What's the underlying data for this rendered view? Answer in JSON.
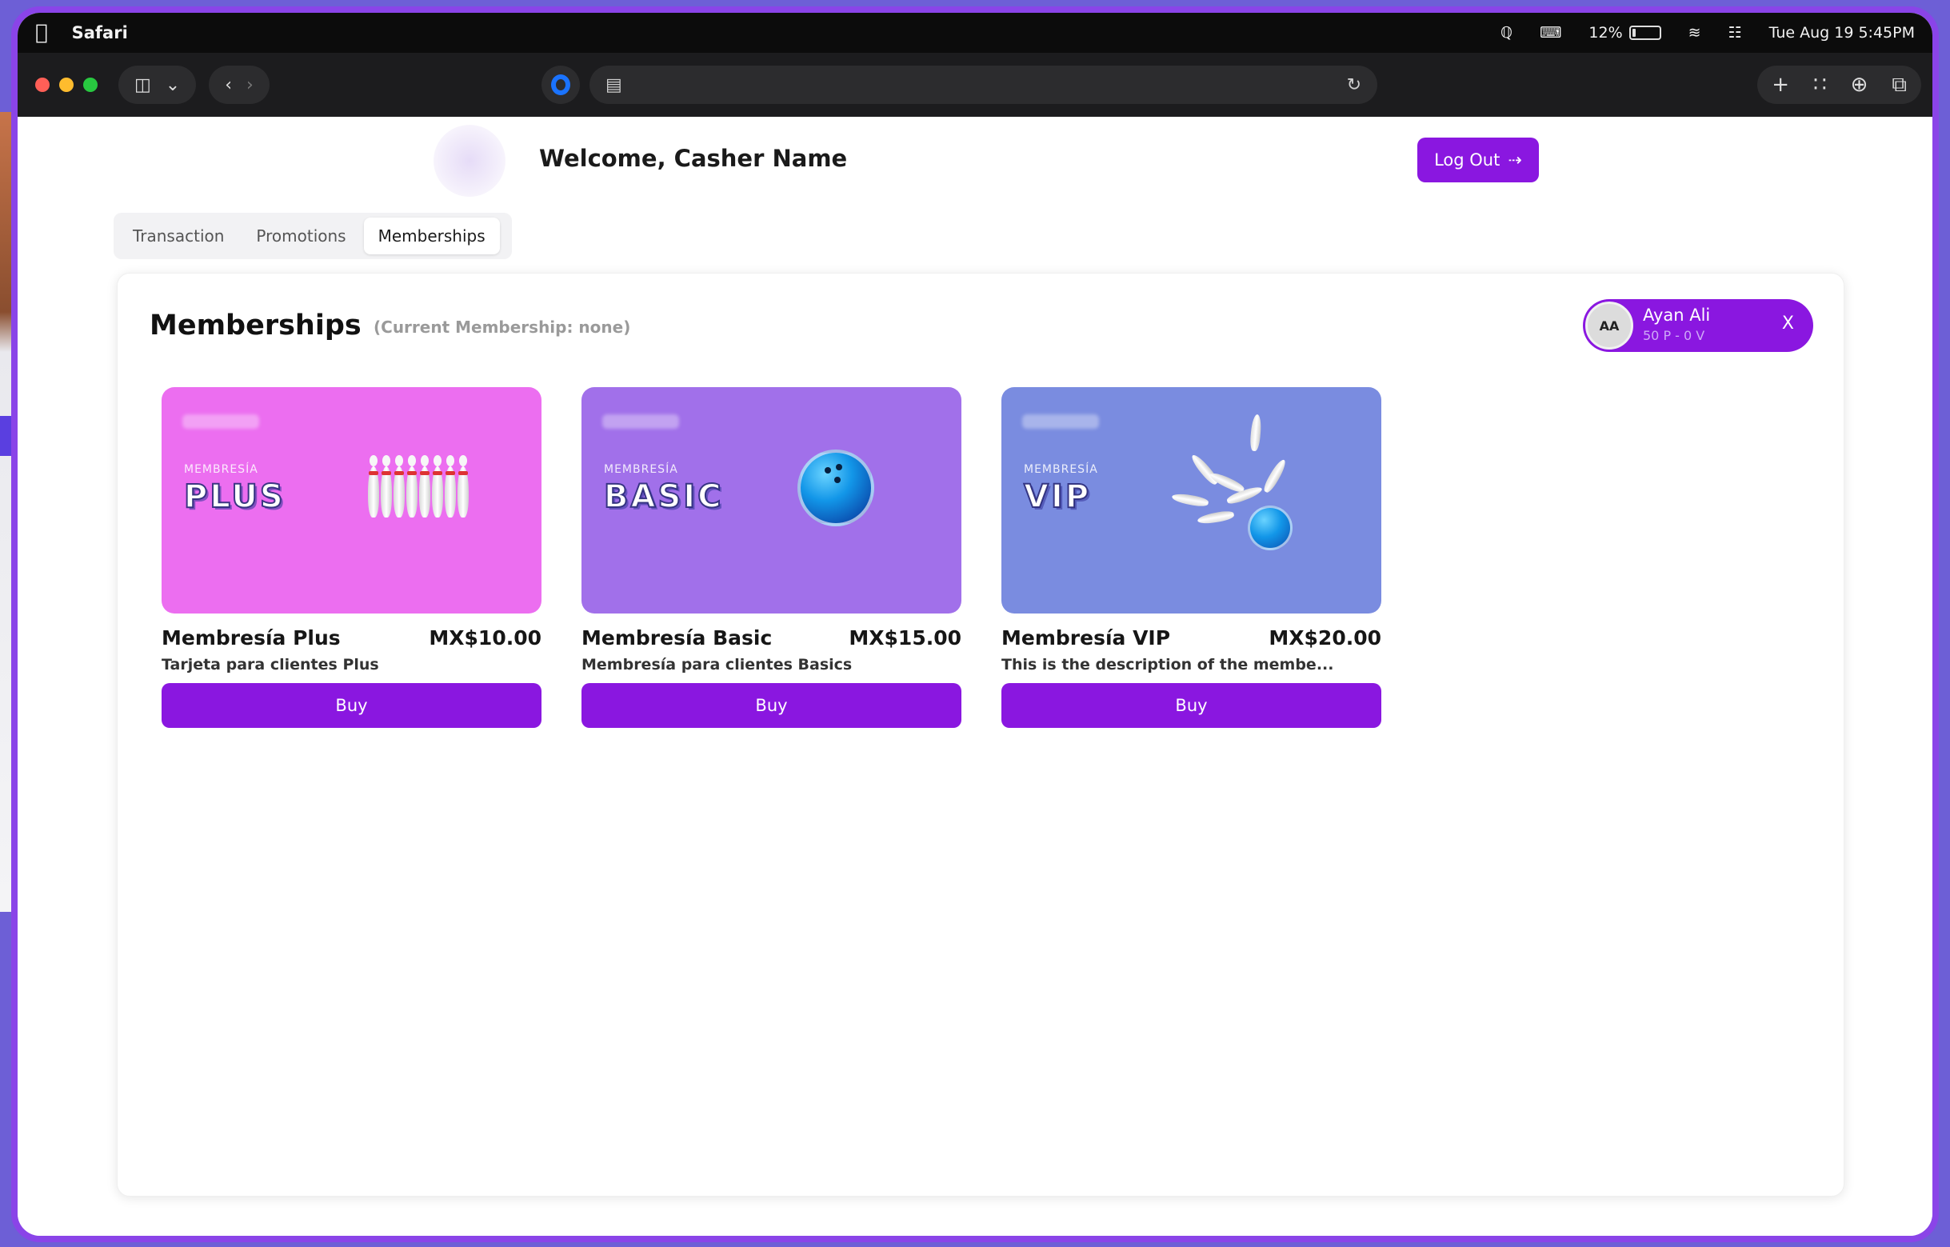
{
  "menubar": {
    "app_name": "Safari",
    "battery_percent": "12%",
    "battery_level": 0.12,
    "datetime": "Tue Aug 19  5:45PM"
  },
  "browser": {
    "address_text": ""
  },
  "header": {
    "welcome": "Welcome, Casher Name",
    "logout_label": "Log Out"
  },
  "tabs": [
    {
      "label": "Transaction",
      "active": false
    },
    {
      "label": "Promotions",
      "active": false
    },
    {
      "label": "Memberships",
      "active": true
    }
  ],
  "memberships_panel": {
    "title": "Memberships",
    "current": "(Current Membership: none)"
  },
  "customer": {
    "initials": "AA",
    "name": "Ayan Ali",
    "stats": "50 P - 0 V",
    "close_label": "X"
  },
  "plans": [
    {
      "tag": "MEMBRESÍA",
      "word": "PLUS",
      "name": "Membresía Plus",
      "price": "MX$10.00",
      "description": "Tarjeta para clientes Plus",
      "buy_label": "Buy",
      "color": "#ec6ef0"
    },
    {
      "tag": "MEMBRESÍA",
      "word": "BASIC",
      "name": "Membresía Basic",
      "price": "MX$15.00",
      "description": "Membresía para clientes Basics",
      "buy_label": "Buy",
      "color": "#a170ea"
    },
    {
      "tag": "MEMBRESÍA",
      "word": "VIP",
      "name": "Membresía VIP",
      "price": "MX$20.00",
      "description": "This is the description of the membe...",
      "buy_label": "Buy",
      "color": "#7a8ce0"
    }
  ],
  "colors": {
    "accent": "#8a17e0",
    "frame": "#8a44e8"
  }
}
